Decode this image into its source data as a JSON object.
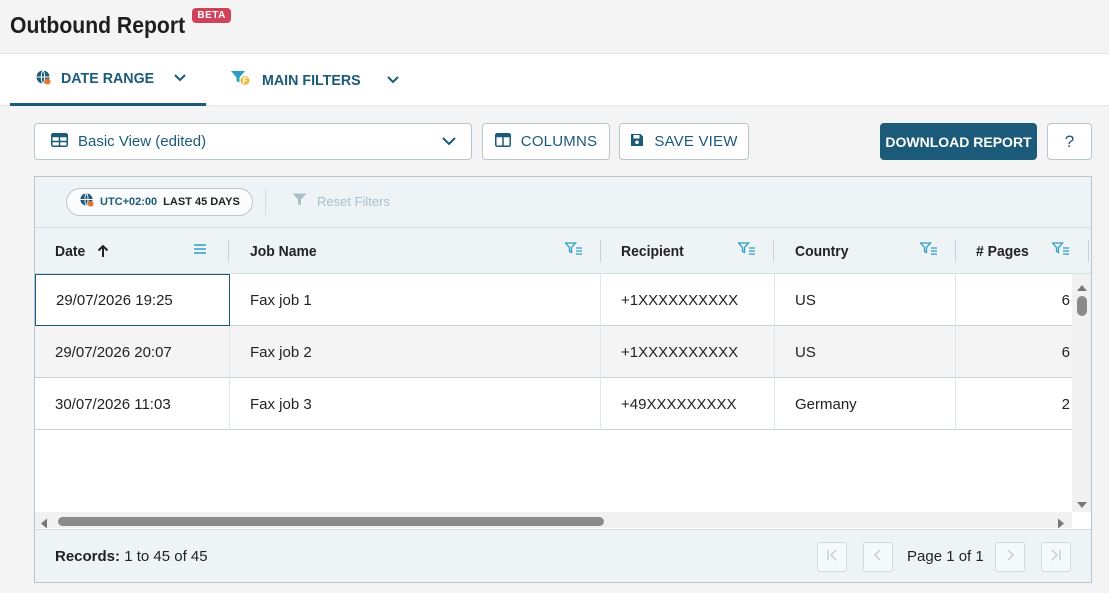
{
  "page": {
    "title": "Outbound Report",
    "badge": "BETA"
  },
  "filter_tabs": [
    {
      "label": "DATE RANGE",
      "active": true
    },
    {
      "label": "MAIN FILTERS",
      "active": false
    }
  ],
  "toolbar": {
    "view_select": "Basic View (edited)",
    "columns_label": "COLUMNS",
    "save_view_label": "SAVE VIEW",
    "download_label": "DOWNLOAD REPORT",
    "help_label": "?"
  },
  "grid_toolbar": {
    "timezone": "UTC+02:00",
    "range": "LAST 45 DAYS",
    "reset_label": "Reset Filters"
  },
  "columns": [
    {
      "label": "Date",
      "sort": "asc"
    },
    {
      "label": "Job Name"
    },
    {
      "label": "Recipient"
    },
    {
      "label": "Country"
    },
    {
      "label": "# Pages"
    }
  ],
  "rows": [
    [
      "29/07/2026 19:25",
      "Fax job 1",
      "+1XXXXXXXXXX",
      "US",
      "6"
    ],
    [
      "29/07/2026 20:07",
      "Fax job 2",
      "+1XXXXXXXXXX",
      "US",
      "6"
    ],
    [
      "30/07/2026 11:03",
      "Fax job 3",
      "+49XXXXXXXXX",
      "Germany",
      "2"
    ]
  ],
  "footer": {
    "records_label": "Records:",
    "records_value": "1 to 45 of 45",
    "page_label": "Page 1 of 1"
  },
  "colors": {
    "accent": "#1b5a78",
    "beta": "#d0415a",
    "filter_icon": "#2a9fc4"
  }
}
